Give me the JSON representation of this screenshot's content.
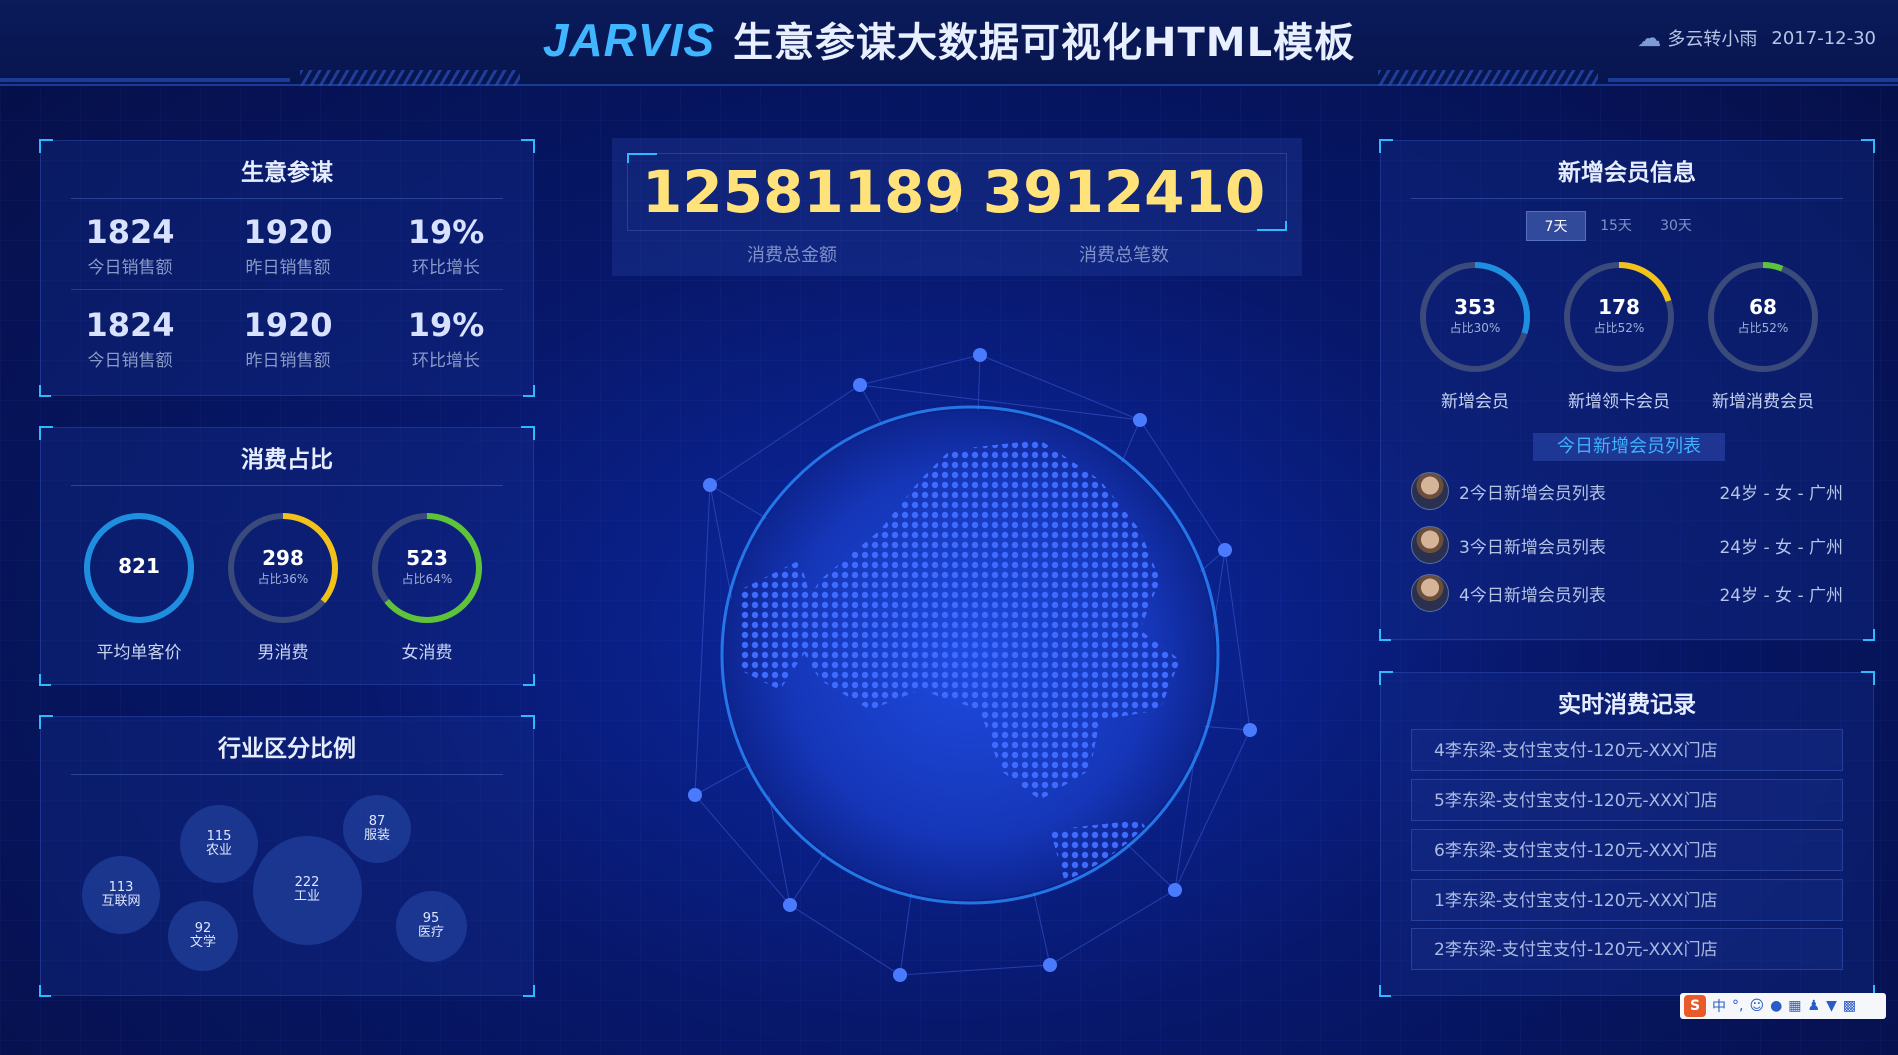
{
  "header": {
    "logo": "JARVIS",
    "title": "生意参谋大数据可视化HTML模板",
    "weather": "多云转小雨",
    "date": "2017-12-30",
    "weather_icon": "cloud-rain-icon"
  },
  "business": {
    "title": "生意参谋",
    "rows": [
      [
        {
          "value": "1824",
          "label": "今日销售额"
        },
        {
          "value": "1920",
          "label": "昨日销售额"
        },
        {
          "value": "19%",
          "label": "环比增长"
        }
      ],
      [
        {
          "value": "1824",
          "label": "今日销售额"
        },
        {
          "value": "1920",
          "label": "昨日销售额"
        },
        {
          "value": "19%",
          "label": "环比增长"
        }
      ]
    ]
  },
  "consumption": {
    "title": "消费占比",
    "rings": [
      {
        "value": "821",
        "pct": "",
        "label": "平均单客价",
        "fraction": 1.0,
        "color": "#1e8fe0"
      },
      {
        "value": "298",
        "pct": "占比36%",
        "label": "男消费",
        "fraction": 0.36,
        "color": "#f2c21b"
      },
      {
        "value": "523",
        "pct": "占比64%",
        "label": "女消费",
        "fraction": 0.64,
        "color": "#5fc33a"
      }
    ]
  },
  "industry": {
    "title": "行业区分比例",
    "bubbles": [
      {
        "value": "115",
        "name": "农业"
      },
      {
        "value": "87",
        "name": "服装"
      },
      {
        "value": "222",
        "name": "工业"
      },
      {
        "value": "113",
        "name": "互联网"
      },
      {
        "value": "92",
        "name": "文学"
      },
      {
        "value": "95",
        "name": "医疗"
      }
    ]
  },
  "totals": {
    "amount": "12581189",
    "amount_label": "消费总金额",
    "count": "3912410",
    "count_label": "消费总笔数"
  },
  "members": {
    "title": "新增会员信息",
    "tabs": [
      "7天",
      "15天",
      "30天"
    ],
    "active_tab": "7天",
    "rings": [
      {
        "value": "353",
        "pct": "占比30%",
        "label": "新增会员",
        "fraction": 0.3,
        "color": "#1e8fe0"
      },
      {
        "value": "178",
        "pct": "占比52%",
        "label": "新增领卡会员",
        "fraction": 0.2,
        "color": "#f2c21b"
      },
      {
        "value": "68",
        "pct": "占比52%",
        "label": "新增消费会员",
        "fraction": 0.06,
        "color": "#5fc33a"
      }
    ],
    "list_title": "今日新增会员列表",
    "list": [
      {
        "name": "2今日新增会员列表",
        "info": "24岁 - 女 - 广州"
      },
      {
        "name": "3今日新增会员列表",
        "info": "24岁 - 女 - 广州"
      },
      {
        "name": "4今日新增会员列表",
        "info": "24岁 - 女 - 广州"
      }
    ]
  },
  "records": {
    "title": "实时消费记录",
    "items": [
      "4李东梁-支付宝支付-120元-XXX门店",
      "5李东梁-支付宝支付-120元-XXX门店",
      "6李东梁-支付宝支付-120元-XXX门店",
      "1李东梁-支付宝支付-120元-XXX门店",
      "2李东梁-支付宝支付-120元-XXX门店"
    ]
  },
  "ime": {
    "logo": "S",
    "lang": "中"
  }
}
